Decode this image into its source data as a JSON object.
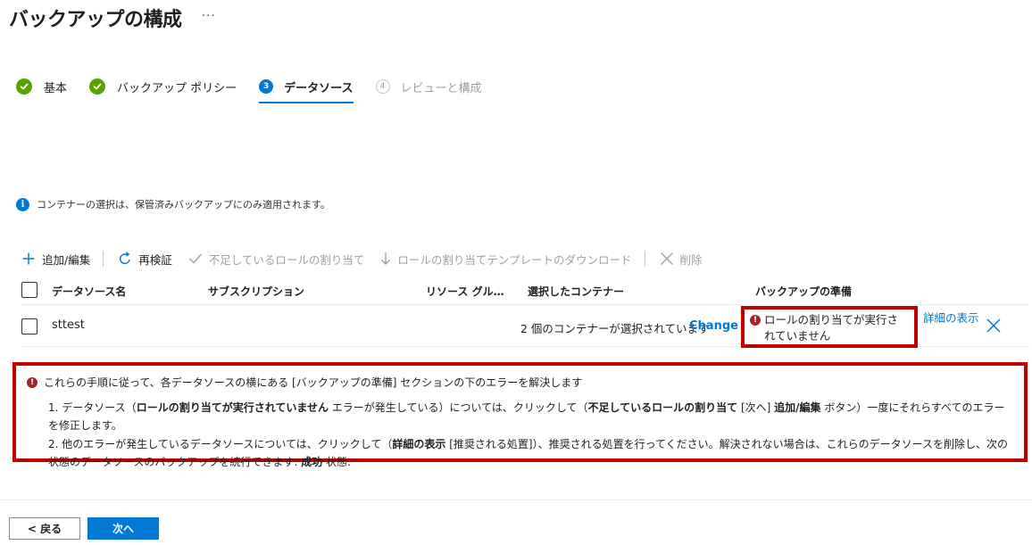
{
  "header": {
    "title": "バックアップの構成",
    "more": "···"
  },
  "steps": [
    {
      "label": "基本",
      "state": "done"
    },
    {
      "label": "バックアップ ポリシー",
      "state": "done"
    },
    {
      "number": "3",
      "label": "データソース",
      "state": "active"
    },
    {
      "number": "4",
      "label": "レビューと構成",
      "state": "pending"
    }
  ],
  "info": {
    "icon": "i",
    "text": "コンテナーの選択は、保管済みバックアップにのみ適用されます。"
  },
  "toolbar": {
    "add_edit": "追加/編集",
    "revalidate": "再検証",
    "assign_missing_roles": "不足しているロールの割り当て",
    "download_template": "ロールの割り当てテンプレートのダウンロード",
    "delete": "削除"
  },
  "table": {
    "headers": {
      "datasource_name": "データソース名",
      "subscription": "サブスクリプション",
      "resource_group": "リソース グル…",
      "selected_container": "選択したコンテナー",
      "backup_readiness": "バックアップの準備"
    },
    "rows": [
      {
        "name": "sttest",
        "container_text": "2 個のコンテナーが選択されています",
        "change_link": "Change",
        "readiness_error": "ロールの割り当てが実行されていません",
        "details_link": "詳細の表示"
      }
    ]
  },
  "instructions": {
    "heading": "これらの手順に従って、各データソースの横にある [バックアップの準備] セクションの下のエラーを解決します",
    "item1": {
      "num": "1.",
      "a": "データソース（",
      "b": "ロールの割り当てが実行されていません",
      "c": " エラーが発生している）については、クリックして（",
      "d": "不足しているロールの割り当て",
      "e": " [次へ] ",
      "f": "追加/編集",
      "g": " ボタン）一度にそれらすべてのエラーを修正します。"
    },
    "item2": {
      "num": "2.",
      "a": "他のエラーが発生しているデータソースについては、クリックして（",
      "b": "詳細の表示",
      "c": " [推奨される処置]）、推奨される処置を行ってください。解決されない場合は、これらのデータソースを削除し、次の状態のデータソースのバックアップを続行できます: ",
      "d": "成功",
      "e": " 状態."
    }
  },
  "footer": {
    "back": "< 戻る",
    "next": "次へ"
  },
  "colors": {
    "accent": "#0078d4",
    "success": "#57a300",
    "error": "#a4262c",
    "highlight": "#c00000"
  }
}
